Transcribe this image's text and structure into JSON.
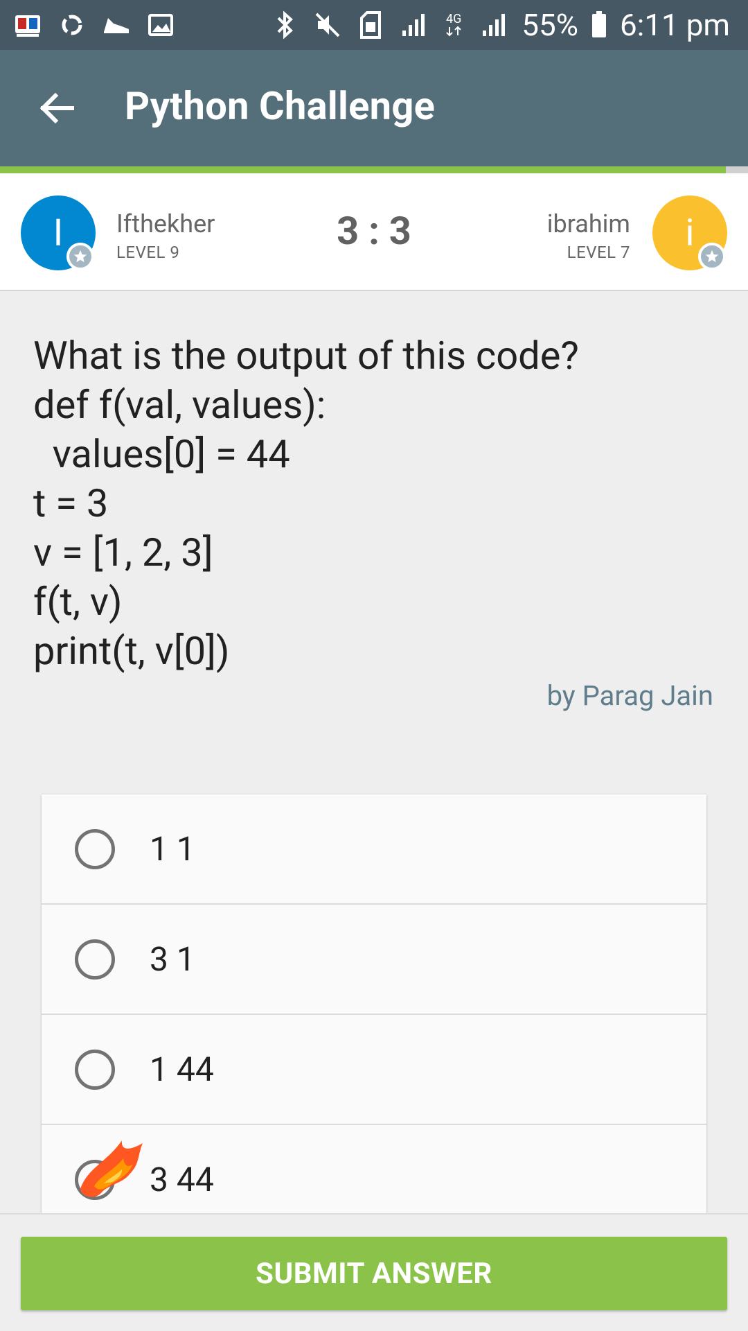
{
  "status_bar": {
    "left_icons": [
      "bangla-keyboard-icon",
      "sync-icon",
      "shoe-icon",
      "image-icon"
    ],
    "right_icons": [
      "bluetooth-icon",
      "mute-icon",
      "sim-icon",
      "signal-icon",
      "network-4g-icon",
      "signal-icon"
    ],
    "network_label": "4G",
    "battery_text": "55%",
    "time": "6:11 pm"
  },
  "app_bar": {
    "title": "Python Challenge",
    "back_icon": "arrow-left-icon"
  },
  "progress": {
    "fraction": 0.97,
    "color": "#8bc34a"
  },
  "players": {
    "left": {
      "initial": "I",
      "name": "Ifthekher",
      "level": "LEVEL 9",
      "color": "#0288d1"
    },
    "right": {
      "initial": "i",
      "name": "ibrahim",
      "level": "LEVEL 7",
      "color": "#fbc02d"
    },
    "score": "3 : 3"
  },
  "question": {
    "text": "What is the output of this code?\ndef f(val, values):\n  values[0] = 44\nt = 3\nv = [1, 2, 3]\nf(t, v)\nprint(t, v[0])",
    "author": "by Parag Jain"
  },
  "options": [
    {
      "label": "1 1"
    },
    {
      "label": "3 1"
    },
    {
      "label": "1 44"
    },
    {
      "label": "3 44"
    }
  ],
  "submit_label": "SUBMIT ANSWER",
  "colors": {
    "status_bar": "#465864",
    "app_bar": "#546e7a",
    "accent": "#8bc34a"
  }
}
